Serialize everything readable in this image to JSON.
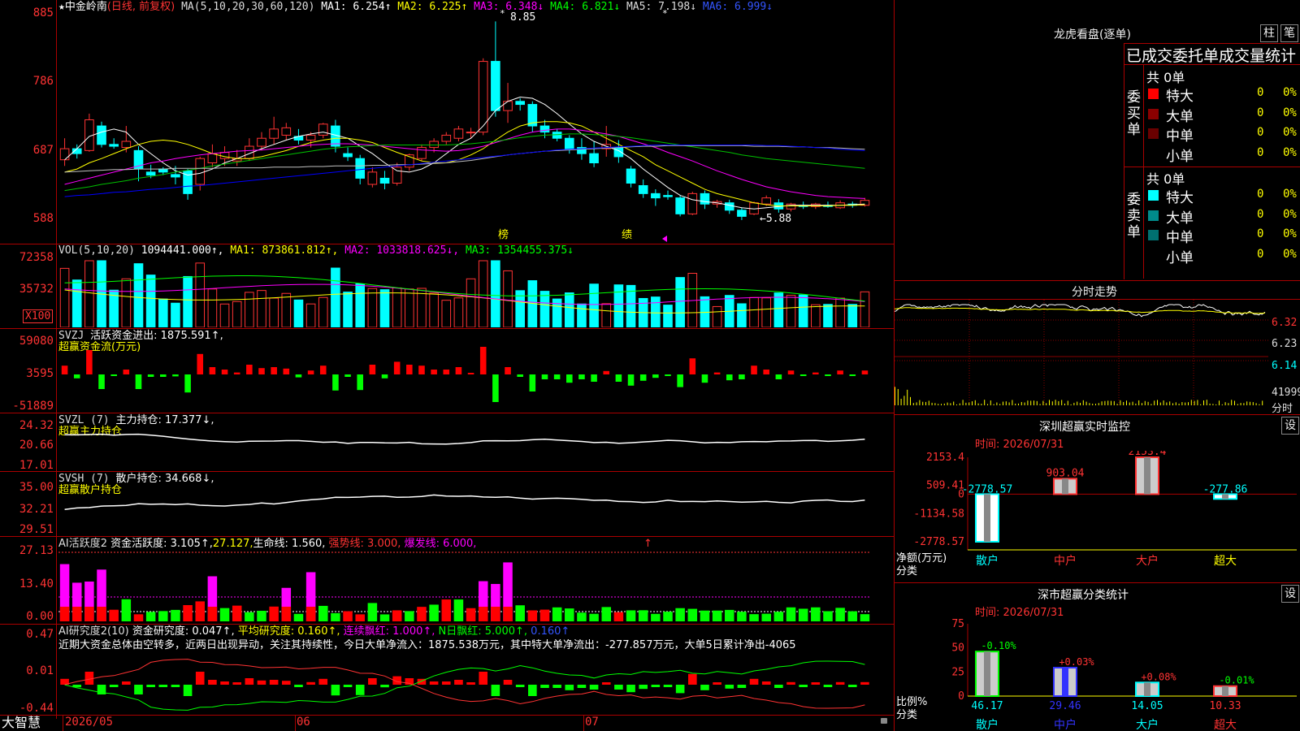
{
  "main_header": {
    "star": "★",
    "stock_name": "中金岭南",
    "mode": "(日线, 前复权)",
    "ma_label": "MA(5,10,20,30,60,120)",
    "ma1": "MA1: 6.254↑",
    "ma2": "MA2: 6.225↑",
    "ma3": "MA3: 6.348↓",
    "ma4": "MA4: 6.821↓",
    "ma5": "MA5: 7.198↓",
    "ma6": "MA6: 6.999↓"
  },
  "main_axis": [
    "885",
    "786",
    "687",
    "588"
  ],
  "main_annotations": {
    "high": "8.85",
    "low": "←5.88",
    "bang": "榜",
    "ji": "绩",
    "hi_star": "*",
    "star2": "*"
  },
  "vol_header": {
    "label": "VOL(5,10,20)",
    "v": "1094441.000↑,",
    "ma1": "MA1: 873861.812↑,",
    "ma2": "MA2: 1033818.625↓,",
    "ma3": "MA3: 1354455.375↓"
  },
  "vol_axis": [
    "72358",
    "35732"
  ],
  "vol_unit": "X100",
  "svzj_header": {
    "label": "SVZJ",
    "t": "活跃资金进出: 1875.591↑,",
    "sub": "超赢资金流(万元)"
  },
  "svzj_axis": [
    "59080",
    "3595",
    "-51889"
  ],
  "svzl_header": {
    "label": "SVZL (7)",
    "t": "主力持仓: 17.377↓,",
    "sub": "超赢主力持仓"
  },
  "svzl_axis": [
    "24.32",
    "20.66",
    "17.01"
  ],
  "svsh_header": {
    "label": "SVSH (7)",
    "t": "散户持仓: 34.668↓,",
    "sub": "超赢散户持仓"
  },
  "svsh_axis": [
    "35.00",
    "32.21",
    "29.51"
  ],
  "ai1_header": {
    "label": "AI活跃度2",
    "a": "资金活跃度: 3.105↑,",
    "b": "27.127,",
    "c": "生命线: 1.560,",
    "d": "强势线: 3.000,",
    "e": "爆发线: 6.000,",
    "f": "↑"
  },
  "ai1_axis": [
    "27.13",
    "13.40",
    "0.00"
  ],
  "ai2_header": {
    "label": "AI研究度2(10)",
    "a": "资金研究度: 0.047↑,",
    "b": "平均研究度: 0.160↑,",
    "c": "连续飘红: 1.000↑,",
    "d": "N日飘红: 5.000↑,",
    "e": "0.160↑"
  },
  "ai2_text": "近期大资金总体由空转多，近两日出现异动，关注其持续性，今日大单净流入：1875.538万元，其中特大单净流出：-277.857万元，大单5日累计净出-4065",
  "ai2_axis": [
    "0.47",
    "0.01",
    "-0.44"
  ],
  "bottom_bar": {
    "brand": "大智慧",
    "d1": "2026/05",
    "d2": "06",
    "d3": "07"
  },
  "right": {
    "lhb_title": "龙虎看盘(逐单)",
    "btn_zhu": "柱",
    "btn_bi": "笔",
    "tabs": "已成交委托单成交量统计",
    "buy_group": "委买单",
    "sell_group": "委卖单",
    "buy_total": "共 0单",
    "sell_total": "共 0单",
    "buy_rows": [
      {
        "name": "特大",
        "count": "0",
        "pct": "0%",
        "color": "#ff0000"
      },
      {
        "name": "大单",
        "count": "0",
        "pct": "0%",
        "color": "#8b0000"
      },
      {
        "name": "中单",
        "count": "0",
        "pct": "0%",
        "color": "#6a0000"
      },
      {
        "name": "小单",
        "count": "0",
        "pct": "0%",
        "color": "#000000"
      }
    ],
    "sell_rows": [
      {
        "name": "特大",
        "count": "0",
        "pct": "0%",
        "color": "#00ffff"
      },
      {
        "name": "大单",
        "count": "0",
        "pct": "0%",
        "color": "#008b8b"
      },
      {
        "name": "中单",
        "count": "0",
        "pct": "0%",
        "color": "#007070"
      },
      {
        "name": "小单",
        "count": "0",
        "pct": "0%",
        "color": "#000000"
      }
    ],
    "fs_title": "分时走势",
    "fs_axis": [
      "6.32",
      "6.23",
      "6.14",
      "41999",
      "分时"
    ],
    "sz_title": "深圳超赢实时监控",
    "sz_btn": "设",
    "sz_time": "时间: 2026/07/31",
    "sz_axis": [
      "2153.4",
      "509.41",
      "0",
      "-1134.58",
      "-2778.57"
    ],
    "sz_ylabel": "净额(万元)",
    "sz_xlabel": "分类",
    "sc_title": "深市超赢分类统计",
    "sc_btn": "设",
    "sc_time": "时间: 2026/07/31",
    "sc_axis": [
      "75",
      "50",
      "25",
      "0"
    ],
    "sc_ylabel": "比例%",
    "sc_xlabel": "分类"
  },
  "chart_data": [
    {
      "type": "bar",
      "title": "深圳超赢实时监控",
      "categories": [
        "散户",
        "中户",
        "大户",
        "超大"
      ],
      "values": [
        -2778.57,
        903.04,
        2153.4,
        -277.86
      ],
      "labels": [
        "-2778.57",
        "903.04",
        "2153.4",
        "-277.86"
      ],
      "ylabel": "净额(万元)",
      "ylim": [
        -2778.57,
        2153.4
      ]
    },
    {
      "type": "bar",
      "title": "深市超赢分类统计",
      "categories": [
        "散户",
        "中户",
        "大户",
        "超大"
      ],
      "values": [
        46.17,
        29.46,
        14.05,
        10.33
      ],
      "changes": [
        "-0.10%",
        "+0.03%",
        "+0.08%",
        "-0.01%"
      ],
      "value_labels": [
        "46.17",
        "29.46",
        "14.05",
        "10.33"
      ],
      "ylabel": "比例%",
      "ylim": [
        0,
        75
      ]
    },
    {
      "type": "line",
      "title": "中金岭南 日线 candlestick",
      "ylim": [
        5.5,
        9.0
      ],
      "candles": [
        [
          6.6,
          6.95,
          6.5,
          6.78
        ],
        [
          6.78,
          6.85,
          6.62,
          6.7
        ],
        [
          6.75,
          7.35,
          6.73,
          7.25
        ],
        [
          7.15,
          7.22,
          6.8,
          6.85
        ],
        [
          6.85,
          6.95,
          6.78,
          6.82
        ],
        [
          6.8,
          7.15,
          6.72,
          6.9
        ],
        [
          6.75,
          6.82,
          6.25,
          6.45
        ],
        [
          6.4,
          6.52,
          6.3,
          6.35
        ],
        [
          6.45,
          6.48,
          6.35,
          6.4
        ],
        [
          6.36,
          6.5,
          6.2,
          6.32
        ],
        [
          6.42,
          6.45,
          5.95,
          6.05
        ],
        [
          6.2,
          6.65,
          6.1,
          6.62
        ],
        [
          6.55,
          6.85,
          6.48,
          6.7
        ],
        [
          6.62,
          6.82,
          6.5,
          6.72
        ],
        [
          6.58,
          6.76,
          6.5,
          6.62
        ],
        [
          6.62,
          6.95,
          6.58,
          6.82
        ],
        [
          6.82,
          7.05,
          6.75,
          6.95
        ],
        [
          6.95,
          7.3,
          6.85,
          7.1
        ],
        [
          7.0,
          7.2,
          6.92,
          7.12
        ],
        [
          6.98,
          7.1,
          6.85,
          6.92
        ],
        [
          6.92,
          7.05,
          6.8,
          7.0
        ],
        [
          7.0,
          7.2,
          6.95,
          7.18
        ],
        [
          7.15,
          7.25,
          6.72,
          6.82
        ],
        [
          6.7,
          6.8,
          6.58,
          6.65
        ],
        [
          6.62,
          6.68,
          6.2,
          6.3
        ],
        [
          6.2,
          6.48,
          6.15,
          6.4
        ],
        [
          6.3,
          6.42,
          6.12,
          6.22
        ],
        [
          6.22,
          6.55,
          6.18,
          6.48
        ],
        [
          6.48,
          6.7,
          6.42,
          6.68
        ],
        [
          6.62,
          6.85,
          6.58,
          6.8
        ],
        [
          6.8,
          6.95,
          6.72,
          6.9
        ],
        [
          6.9,
          7.05,
          6.85,
          7.0
        ],
        [
          6.95,
          7.15,
          6.9,
          7.1
        ],
        [
          7.05,
          7.12,
          6.95,
          7.05
        ],
        [
          7.05,
          8.25,
          7.0,
          8.2
        ],
        [
          8.2,
          8.85,
          7.3,
          7.4
        ],
        [
          7.4,
          7.85,
          7.2,
          7.55
        ],
        [
          7.55,
          7.6,
          7.4,
          7.5
        ],
        [
          7.5,
          7.55,
          7.05,
          7.15
        ],
        [
          7.15,
          7.25,
          6.95,
          7.05
        ],
        [
          7.05,
          7.1,
          6.9,
          6.95
        ],
        [
          6.95,
          7.0,
          6.7,
          6.78
        ],
        [
          6.8,
          6.95,
          6.6,
          6.7
        ],
        [
          6.7,
          6.9,
          6.48,
          6.55
        ],
        [
          6.78,
          7.15,
          6.65,
          6.85
        ],
        [
          6.8,
          6.92,
          6.55,
          6.65
        ],
        [
          6.45,
          6.5,
          6.15,
          6.22
        ],
        [
          6.18,
          6.28,
          5.98,
          6.05
        ],
        [
          6.05,
          6.12,
          5.85,
          5.98
        ],
        [
          6.02,
          6.1,
          5.95,
          6.0
        ],
        [
          5.98,
          6.02,
          5.68,
          5.72
        ],
        [
          5.72,
          6.08,
          5.7,
          6.05
        ],
        [
          6.05,
          6.1,
          5.8,
          5.88
        ],
        [
          5.88,
          5.95,
          5.82,
          5.92
        ],
        [
          5.9,
          5.95,
          5.72,
          5.78
        ],
        [
          5.78,
          5.82,
          5.62,
          5.68
        ],
        [
          5.72,
          5.92,
          5.7,
          5.9
        ],
        [
          5.88,
          6.02,
          5.85,
          5.98
        ],
        [
          5.9,
          5.96,
          5.74,
          5.8
        ],
        [
          5.8,
          5.9,
          5.76,
          5.88
        ],
        [
          5.86,
          5.92,
          5.8,
          5.84
        ],
        [
          5.84,
          5.9,
          5.8,
          5.88
        ],
        [
          5.86,
          5.92,
          5.82,
          5.84
        ],
        [
          5.82,
          5.94,
          5.8,
          5.9
        ],
        [
          5.88,
          5.92,
          5.82,
          5.86
        ],
        [
          5.86,
          5.98,
          5.84,
          5.94
        ]
      ],
      "ma_series": [
        {
          "name": "MA1",
          "color": "#ffffff",
          "values": [
            6.6,
            6.78,
            6.98,
            7.05,
            7.1,
            7.05,
            6.85,
            6.7,
            6.55,
            6.42,
            6.35,
            6.38,
            6.45,
            6.55,
            6.62,
            6.7,
            6.78,
            6.85,
            6.92,
            6.98,
            7.02,
            7.05,
            7.0,
            6.95,
            6.82,
            6.7,
            6.55,
            6.42,
            6.4,
            6.45,
            6.55,
            6.7,
            6.85,
            6.95,
            7.15,
            7.4,
            7.55,
            7.62,
            7.6,
            7.5,
            7.35,
            7.18,
            7.02,
            6.9,
            6.82,
            6.75,
            6.62,
            6.45,
            6.3,
            6.15,
            6.02,
            5.95,
            5.92,
            5.9,
            5.86,
            5.82,
            5.8,
            5.82,
            5.84,
            5.86,
            5.86,
            5.86,
            5.86,
            5.86,
            5.87,
            5.88
          ]
        },
        {
          "name": "MA2",
          "color": "#ffff00",
          "values": [
            6.4,
            6.45,
            6.55,
            6.62,
            6.7,
            6.78,
            6.85,
            6.9,
            6.92,
            6.9,
            6.85,
            6.78,
            6.7,
            6.65,
            6.62,
            6.62,
            6.65,
            6.7,
            6.75,
            6.82,
            6.88,
            6.92,
            6.95,
            6.95,
            6.92,
            6.88,
            6.8,
            6.72,
            6.65,
            6.58,
            6.55,
            6.55,
            6.6,
            6.68,
            6.78,
            6.92,
            7.05,
            7.15,
            7.2,
            7.22,
            7.22,
            7.2,
            7.15,
            7.05,
            6.95,
            6.85,
            6.75,
            6.65,
            6.52,
            6.42,
            6.32,
            6.22,
            6.12,
            6.05,
            6.0,
            5.95,
            5.9,
            5.87,
            5.85,
            5.85,
            5.85,
            5.85,
            5.85,
            5.86,
            5.86,
            5.87
          ]
        },
        {
          "name": "MA3",
          "color": "#ff00ff",
          "values": [
            6.2,
            6.25,
            6.3,
            6.35,
            6.4,
            6.45,
            6.5,
            6.55,
            6.58,
            6.62,
            6.65,
            6.68,
            6.7,
            6.72,
            6.74,
            6.75,
            6.76,
            6.78,
            6.8,
            6.82,
            6.84,
            6.85,
            6.86,
            6.86,
            6.85,
            6.84,
            6.82,
            6.8,
            6.78,
            6.76,
            6.75,
            6.74,
            6.75,
            6.78,
            6.82,
            6.88,
            6.94,
            7.0,
            7.05,
            7.08,
            7.1,
            7.1,
            7.08,
            7.05,
            7.02,
            6.98,
            6.92,
            6.86,
            6.8,
            6.72,
            6.65,
            6.58,
            6.5,
            6.42,
            6.35,
            6.28,
            6.22,
            6.16,
            6.12,
            6.08,
            6.05,
            6.02,
            6.0,
            5.99,
            5.98,
            5.97
          ]
        },
        {
          "name": "MA4",
          "color": "#00c000",
          "values": [
            6.1,
            6.13,
            6.16,
            6.2,
            6.23,
            6.26,
            6.3,
            6.33,
            6.36,
            6.4,
            6.43,
            6.46,
            6.5,
            6.53,
            6.56,
            6.59,
            6.62,
            6.65,
            6.68,
            6.71,
            6.74,
            6.77,
            6.79,
            6.81,
            6.82,
            6.83,
            6.84,
            6.84,
            6.84,
            6.84,
            6.84,
            6.84,
            6.85,
            6.86,
            6.88,
            6.9,
            6.93,
            6.96,
            6.98,
            7.0,
            7.01,
            7.02,
            7.02,
            7.01,
            7.0,
            6.98,
            6.96,
            6.93,
            6.9,
            6.87,
            6.84,
            6.81,
            6.78,
            6.75,
            6.72,
            6.68,
            6.65,
            6.62,
            6.6,
            6.58,
            6.56,
            6.54,
            6.52,
            6.5,
            6.48,
            6.46
          ]
        },
        {
          "name": "MA5",
          "color": "#c0c0c0",
          "values": [
            6.4,
            6.41,
            6.42,
            6.43,
            6.44,
            6.44,
            6.45,
            6.45,
            6.45,
            6.46,
            6.46,
            6.46,
            6.46,
            6.47,
            6.47,
            6.47,
            6.47,
            6.48,
            6.48,
            6.48,
            6.49,
            6.49,
            6.5,
            6.5,
            6.5,
            6.51,
            6.51,
            6.52,
            6.52,
            6.53,
            6.54,
            6.55,
            6.57,
            6.59,
            6.62,
            6.65,
            6.68,
            6.7,
            6.72,
            6.74,
            6.75,
            6.76,
            6.77,
            6.78,
            6.79,
            6.8,
            6.81,
            6.82,
            6.82,
            6.83,
            6.83,
            6.83,
            6.83,
            6.83,
            6.83,
            6.83,
            6.82,
            6.82,
            6.82,
            6.81,
            6.81,
            6.8,
            6.8,
            6.79,
            6.78,
            6.77
          ]
        },
        {
          "name": "MA6",
          "color": "#0000ff",
          "values": [
            6.0,
            6.02,
            6.03,
            6.05,
            6.07,
            6.08,
            6.1,
            6.12,
            6.13,
            6.15,
            6.17,
            6.18,
            6.2,
            6.22,
            6.24,
            6.26,
            6.28,
            6.3,
            6.32,
            6.34,
            6.36,
            6.38,
            6.4,
            6.42,
            6.44,
            6.46,
            6.48,
            6.5,
            6.52,
            6.54,
            6.56,
            6.58,
            6.6,
            6.62,
            6.64,
            6.66,
            6.68,
            6.7,
            6.72,
            6.74,
            6.76,
            6.77,
            6.78,
            6.79,
            6.8,
            6.81,
            6.82,
            6.83,
            6.84,
            6.84,
            6.84,
            6.84,
            6.84,
            6.84,
            6.84,
            6.84,
            6.84,
            6.83,
            6.83,
            6.82,
            6.81,
            6.8,
            6.79,
            6.77,
            6.76,
            6.75
          ]
        }
      ]
    }
  ]
}
